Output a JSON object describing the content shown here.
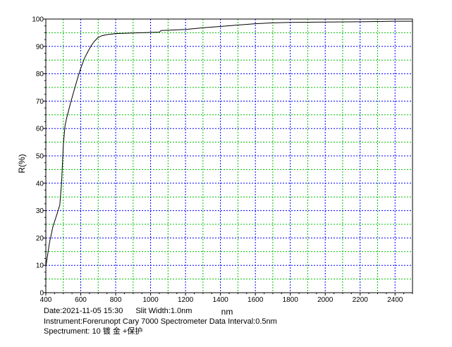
{
  "chart_data": {
    "type": "line",
    "xlabel": "nm",
    "ylabel": "R(%)",
    "xlim": [
      400,
      2500
    ],
    "ylim": [
      0,
      100
    ],
    "x_ticks": [
      "400",
      "600",
      "800",
      "1000",
      "1200",
      "1400",
      "1600",
      "1800",
      "2000",
      "2200",
      "2400"
    ],
    "y_ticks": [
      "0",
      "10",
      "20",
      "30",
      "40",
      "50",
      "60",
      "70",
      "80",
      "90",
      "100"
    ],
    "grid": true,
    "colors": {
      "line": "#000000",
      "grid_major": "#0000ff",
      "grid_minor": "#00c000",
      "axis": "#000000"
    },
    "series": [
      {
        "x": [
          400,
          420,
          440,
          460,
          480,
          490,
          500,
          510,
          520,
          540,
          560,
          580,
          600,
          620,
          640,
          660,
          680,
          700,
          720,
          750,
          800,
          900,
          1000,
          1050,
          1060,
          1100,
          1200,
          1300,
          1400,
          1500,
          1600,
          1700,
          1800,
          2000,
          2200,
          2300,
          2400,
          2500
        ],
        "y": [
          9.5,
          18,
          24,
          28,
          32,
          40,
          54,
          61,
          64,
          69,
          73.5,
          78,
          82,
          85.5,
          88,
          90.3,
          92,
          93.3,
          93.9,
          94.3,
          94.7,
          94.9,
          95.1,
          95.2,
          95.8,
          95.9,
          96.2,
          96.8,
          97.3,
          97.8,
          98.3,
          98.6,
          98.8,
          98.9,
          99.0,
          99.1,
          99.2,
          99.2
        ]
      }
    ]
  },
  "info": {
    "date": "Date:2021-11-05 15:30",
    "slit": "Slit Width:1.0nm",
    "instrument": "Instrument:Forerunopt Cary 7000 Spectrometer Data Interval:0.5nm",
    "spectrum": "Spectrument: 10 镀 金 +保护"
  }
}
